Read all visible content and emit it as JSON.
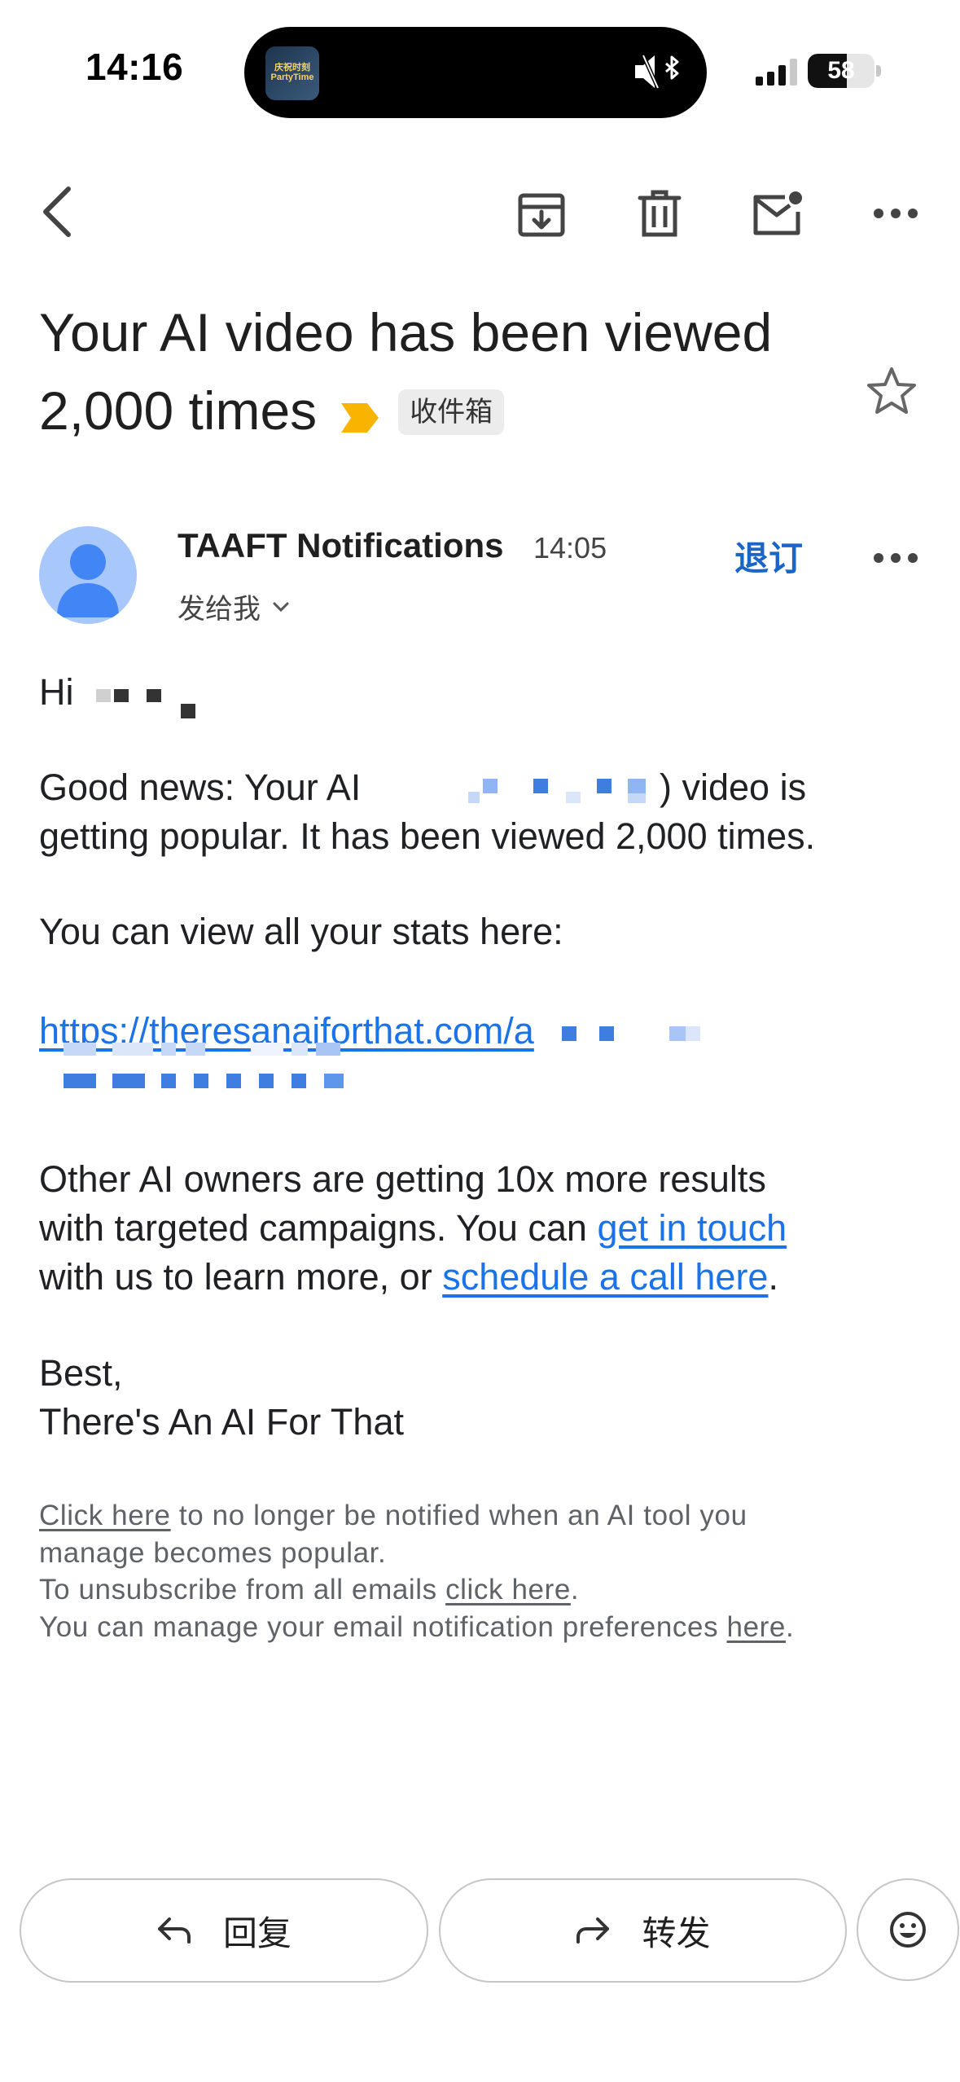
{
  "status_bar": {
    "time": "14:16",
    "battery_percent": "58",
    "battery_level": 0.58,
    "island_app_text": "庆祝时刻 PartyTime"
  },
  "toolbar": {
    "icons": [
      "back-arrow-icon",
      "archive-icon",
      "delete-icon",
      "mark-unread-icon",
      "more-vert-icon"
    ]
  },
  "email": {
    "subject": "Your AI video has been viewed 2,000 times",
    "label": "收件箱",
    "sender_name": "TAAFT Notifications",
    "sent_time": "14:05",
    "to_label": "发给我",
    "unsubscribe_label": "退订",
    "greeting": "Hi",
    "para1_start": "Good news: Your AI",
    "para1_mid": ") video is",
    "para1_line2": "getting popular. It has been viewed 2,000 times.",
    "para2": "You can view all your stats here:",
    "stats_link": "https://theresanaiforthat.com/a",
    "para3_line1": "Other AI owners are getting 10x more results",
    "para3_line2_pre": "with targeted campaigns. You can ",
    "get_in_touch": "get in touch",
    "para3_line3_pre": "with us to learn more, or ",
    "schedule_link": "schedule a call here",
    "period": ".",
    "signoff": "Best,",
    "signature": "There's An AI For That",
    "footer": {
      "click_here": "Click here",
      "line1_rest": " to no longer be notified when an AI tool you",
      "line2": "manage becomes popular.",
      "line3_pre": "To unsubscribe from all emails ",
      "line3_link": "click here",
      "line4_pre": "You can manage your email notification preferences ",
      "line4_link": "here",
      "dot": "."
    }
  },
  "actions": {
    "reply": "回复",
    "forward": "转发"
  },
  "colors": {
    "accent_blue": "#1a73e8",
    "unsubscribe_blue": "#1a66c7",
    "avatar_bg": "#a8c7fa",
    "avatar_fg": "#4285f4",
    "important_marker": "#f9b400"
  }
}
